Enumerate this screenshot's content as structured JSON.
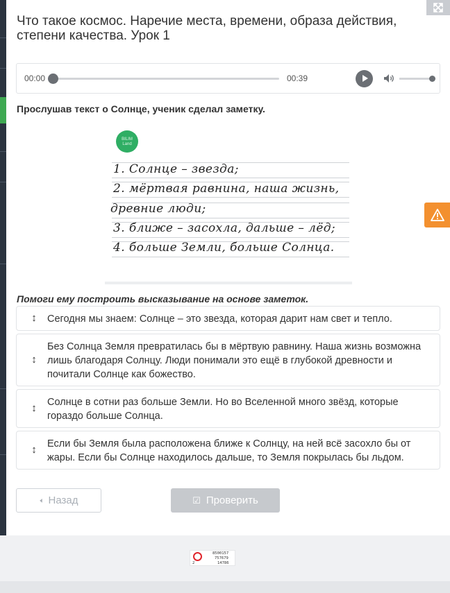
{
  "lesson": {
    "title": "Что такое космос. Наречие места, времени, образа действия, степени качества. Урок 1"
  },
  "player": {
    "current_time": "00:00",
    "duration": "00:39",
    "progress": 0,
    "volume": 1.0,
    "play_icon": "play-icon",
    "volume_icon": "speaker-icon"
  },
  "instruction": "Прослушав текст о Солнце, ученик сделал заметку.",
  "note_image": {
    "logo_text_1": "BILIM",
    "logo_text_2": "Land",
    "lines": [
      "1. Солнце – звезда;",
      "2. мёртвая равнина, наша жизнь,",
      "древние люди;",
      "3. ближе – засохла, дальше – лёд;",
      "4. больше Земли, больше Солнца."
    ]
  },
  "helper_text": "Помоги ему построить высказывание на основе заметок.",
  "sortable_items": [
    "Сегодня мы знаем: Солнце – это звезда, которая дарит нам свет и тепло.",
    "Без Солнца Земля превратилась бы в мёртвую равнину. Наша жизнь возможна лишь благодаря Солнцу. Люди понимали это ещё в глубокой древности и почитали Солнце как божество.",
    "Солнце в сотни раз больше Земли. Но во Вселенной много звёзд, которые гораздо больше Солнца.",
    "Если бы Земля была расположена ближе к Солнцу, на ней всё засохло бы от жары. Если бы Солнце находилось дальше, то Земля покрылась бы льдом."
  ],
  "handle_glyph": "↕",
  "buttons": {
    "back_label": "Назад",
    "check_label": "Проверить"
  },
  "footer_counter": {
    "line1": "8500157",
    "line2": "757679",
    "line3": "14786",
    "small": "2"
  },
  "colors": {
    "accent_green": "#3ea952",
    "warning_orange": "#f3902f",
    "disabled_gray": "#c6c9cd",
    "logo_green": "#2fae64"
  }
}
